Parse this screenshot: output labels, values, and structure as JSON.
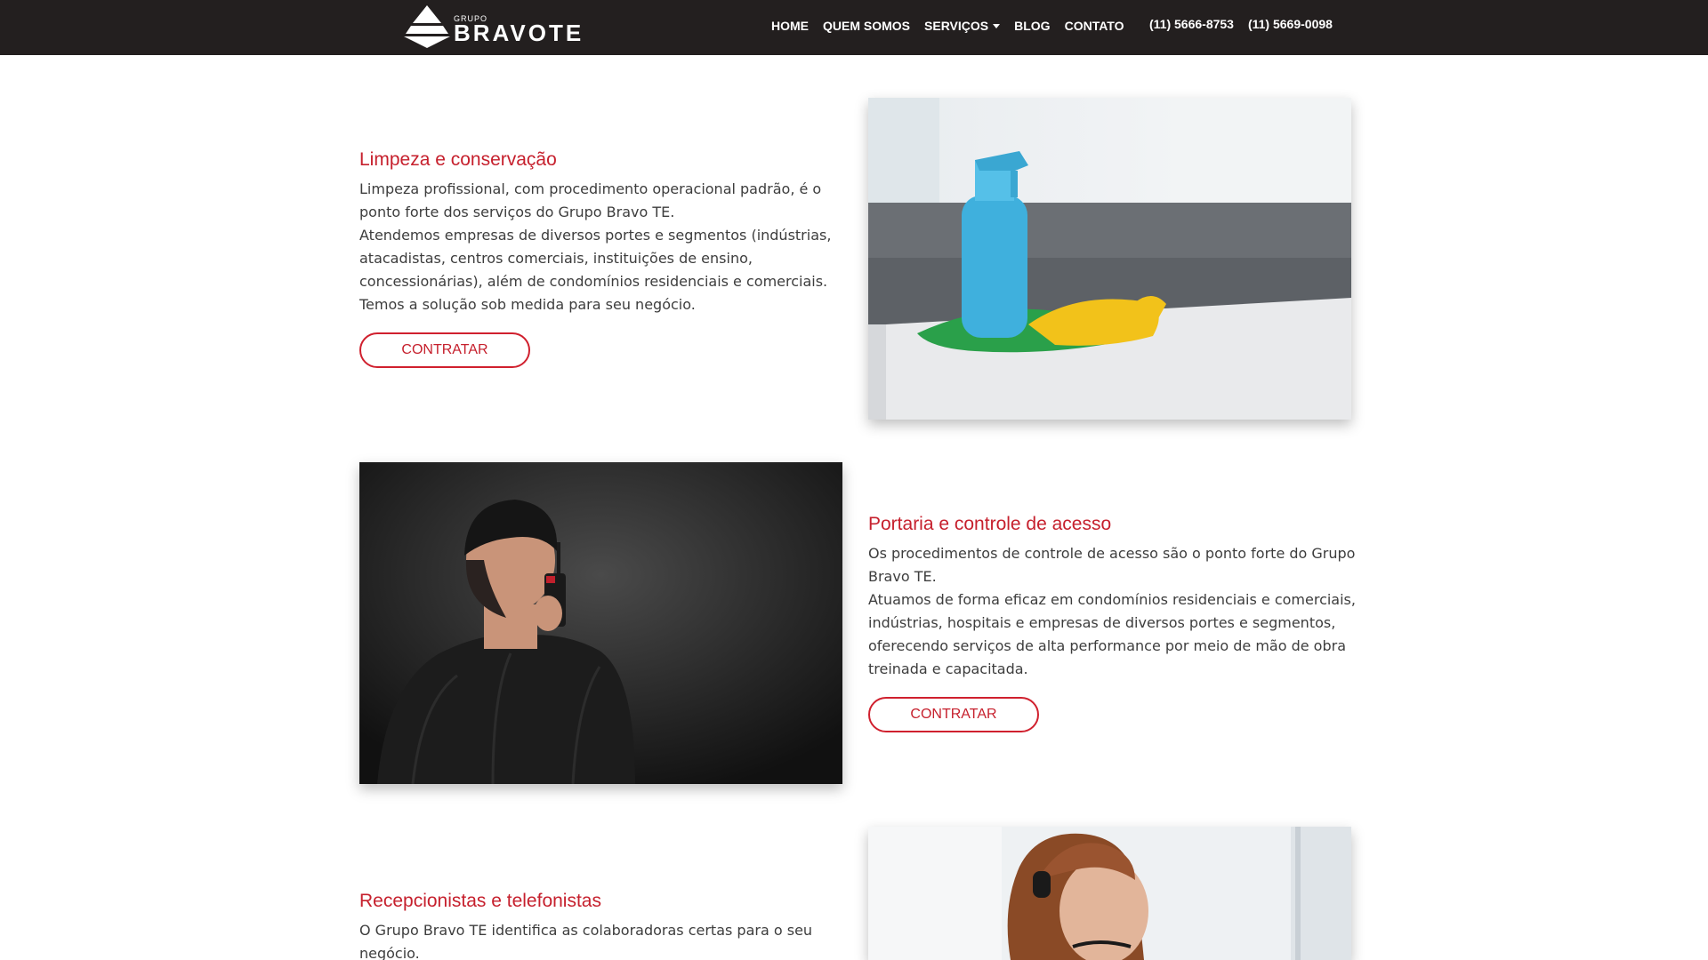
{
  "brand": {
    "small": "GRUPO",
    "name": "BRAVOTE"
  },
  "nav": {
    "home": "HOME",
    "quem_somos": "QUEM SOMOS",
    "servicos": "SERVIÇOS",
    "blog": "BLOG",
    "contato": "CONTATO"
  },
  "phones": [
    "(11) 5666-8753",
    "(11) 5669-0098"
  ],
  "services": [
    {
      "title": "Limpeza e conservação",
      "lines": [
        "Limpeza profissional, com procedimento operacional padrão, é o ponto forte dos serviços do Grupo Bravo TE.",
        "Atendemos empresas de diversos portes e segmentos (indústrias, atacadistas, centros comerciais, instituições de ensino, concessionárias), além de condomínios residenciais e comerciais.",
        "Temos a solução sob medida para seu negócio."
      ],
      "button": "CONTRATAR"
    },
    {
      "title": "Portaria e controle de acesso",
      "lines": [
        "Os procedimentos de controle de acesso são o ponto forte do Grupo Bravo TE.",
        "Atuamos de forma eficaz em condomínios residenciais e comerciais, indústrias, hospitais e empresas de diversos portes e segmentos, oferecendo serviços de alta performance por meio de mão de obra treinada e capacitada."
      ],
      "button": "CONTRATAR"
    },
    {
      "title": "Recepcionistas e telefonistas",
      "lines": [
        "O Grupo Bravo TE identifica as colaboradoras certas para o seu negócio."
      ]
    }
  ],
  "colors": {
    "header_bg": "#231f1f",
    "accent": "#c6202d"
  }
}
